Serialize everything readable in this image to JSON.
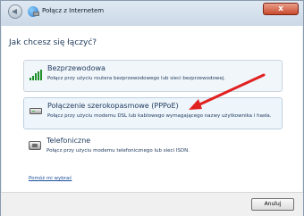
{
  "window": {
    "title": "Połącz z Internetem",
    "close_label": "x"
  },
  "page": {
    "heading": "Jak chcesz się łączyć?"
  },
  "options": [
    {
      "title": "Bezprzewodowa",
      "description": "Połącz przy użyciu routera bezprzewodowego lub sieci bezprzewodowej.",
      "icon": "wireless-signal-icon"
    },
    {
      "title": "Połączenie szerokopasmowe (PPPoE)",
      "description": "Połącz przy użyciu modemu DSL lub kablowego wymagającego nazwy użytkownika i hasła.",
      "icon": "broadband-modem-icon"
    },
    {
      "title": "Telefoniczne",
      "description": "Połącz przy użyciu modemu telefonicznego lub sieci ISDN.",
      "icon": "dialup-phone-icon"
    }
  ],
  "help_link": "Pomóż mi wybrać",
  "footer": {
    "cancel_label": "Anuluj"
  },
  "colors": {
    "annotation_arrow": "#e12020"
  }
}
